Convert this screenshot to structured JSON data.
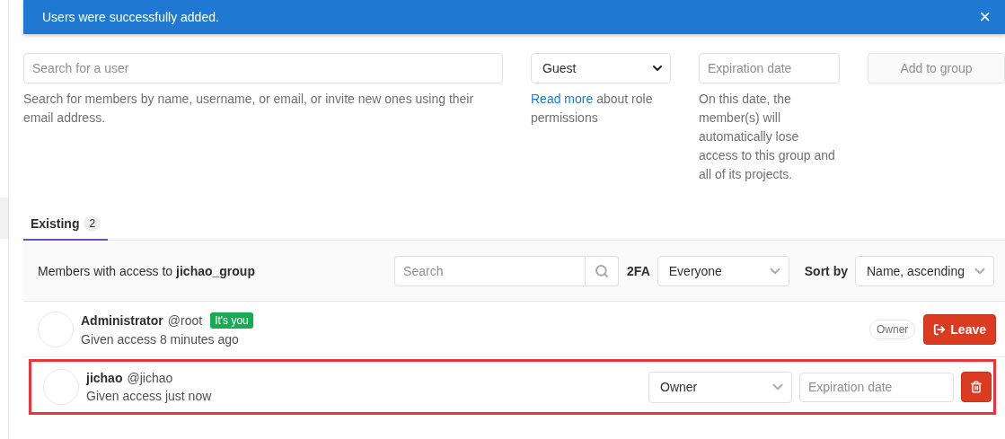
{
  "flash": {
    "message": "Users were successfully added.",
    "close": "×"
  },
  "invite_form": {
    "search": {
      "placeholder": "Search for a user",
      "help": "Search for members by name, username, or email, or invite new ones using their email address."
    },
    "role": {
      "value": "Guest",
      "help_link": "Read more",
      "help_rest": " about role permissions"
    },
    "expiration": {
      "placeholder": "Expiration date",
      "help": "On this date, the member(s) will automatically lose access to this group and all of its projects."
    },
    "submit": {
      "label": "Add to group",
      "disabled": true
    }
  },
  "tabs": [
    {
      "label": "Existing",
      "count": "2",
      "selected": true
    }
  ],
  "members_panel": {
    "title": "Members with access to **jichao_group**",
    "search": {
      "placeholder": "Search"
    },
    "two_fa": {
      "label": "2FA",
      "value": "Everyone"
    },
    "sort": {
      "label": "Sort by",
      "value": "Name, ascending"
    }
  },
  "members": [
    {
      "kind": "self",
      "name": "Administrator",
      "username": "@root",
      "badge": "It's you",
      "access": "Given access 8 minutes ago",
      "role": "Owner",
      "action": "Leave",
      "highlighted": false
    },
    {
      "kind": "editable",
      "name": "jichao",
      "username": "@jichao",
      "access": "Given access just now",
      "role": "Owner",
      "expiration_placeholder": "Expiration date",
      "highlighted": true
    }
  ]
}
